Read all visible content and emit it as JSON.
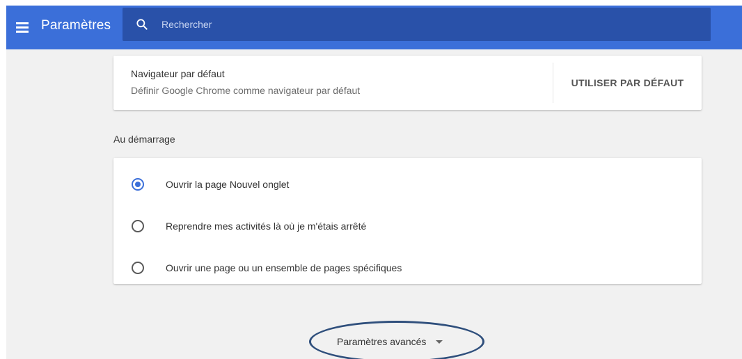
{
  "header": {
    "title": "Paramètres",
    "search_placeholder": "Rechercher",
    "menu_icon": "hamburger-menu-icon",
    "search_icon": "search-icon"
  },
  "default_browser": {
    "title": "Navigateur par défaut",
    "subtitle": "Définir Google Chrome comme navigateur par défaut",
    "button_label": "UTILISER PAR DÉFAUT"
  },
  "startup": {
    "section_label": "Au démarrage",
    "options": [
      {
        "label": "Ouvrir la page Nouvel onglet",
        "selected": true
      },
      {
        "label": "Reprendre mes activités là où je m'étais arrêté",
        "selected": false
      },
      {
        "label": "Ouvrir une page ou un ensemble de pages spécifiques",
        "selected": false
      }
    ]
  },
  "advanced": {
    "label": "Paramètres avancés"
  },
  "colors": {
    "toolbar": "#3b6fd9",
    "search_bg": "#2951a9",
    "page_bg": "#f1f1f1",
    "accent": "#3b6fd9",
    "annotation_ellipse": "#2f4f7c"
  }
}
